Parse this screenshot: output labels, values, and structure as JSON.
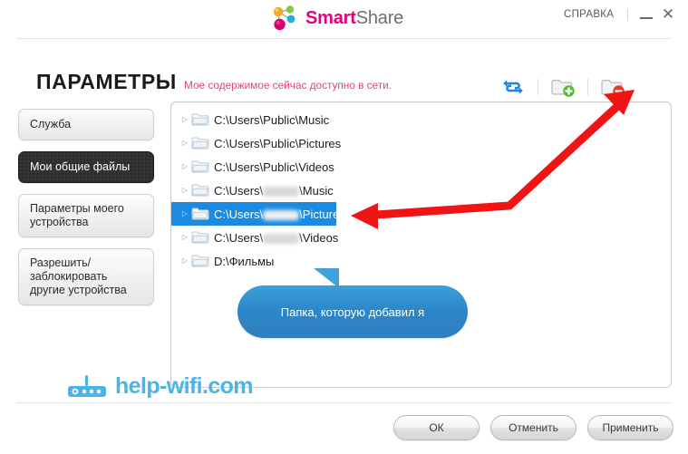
{
  "window": {
    "brand_smart": "Smart",
    "brand_share": "Share",
    "help_label": "СПРАВКА",
    "minimize_label": "—",
    "close_label": "✕",
    "brand_color": "#e4007f"
  },
  "sidebar": {
    "title": "ПАРАМЕТРЫ",
    "items": [
      {
        "label": "Служба",
        "active": false
      },
      {
        "label": "Мои общие файлы",
        "active": true
      },
      {
        "label": "Параметры моего\nустройства",
        "active": false
      },
      {
        "label": "Разрешить/\nзаблокировать\nдругие устройства",
        "active": false
      }
    ]
  },
  "main": {
    "status_note": "Мое содержимое сейчас доступно в сети.",
    "status_note_color": "#e0457b",
    "toolbar": [
      {
        "name": "refresh-icon",
        "title": "Обновить"
      },
      {
        "name": "add-folder-icon",
        "title": "Добавить папку"
      },
      {
        "name": "remove-folder-icon",
        "title": "Удалить папку"
      }
    ],
    "folder_list": [
      {
        "path": "C:\\Users\\Public\\Music",
        "selected": false,
        "redacted": false
      },
      {
        "path": "C:\\Users\\Public\\Pictures",
        "selected": false,
        "redacted": false
      },
      {
        "path": "C:\\Users\\Public\\Videos",
        "selected": false,
        "redacted": false
      },
      {
        "prefix": "C:\\Users\\",
        "suffix": "\\Music",
        "selected": false,
        "redacted": true
      },
      {
        "prefix": "C:\\Users\\",
        "suffix": "\\Pictures",
        "selected": true,
        "redacted": true
      },
      {
        "prefix": "C:\\Users\\",
        "suffix": "\\Videos",
        "selected": false,
        "redacted": true
      },
      {
        "path": "D:\\Фильмы",
        "selected": false,
        "redacted": false
      }
    ],
    "selection_color": "#1b8ae0"
  },
  "callout": {
    "text": "Папка, которую добавил я",
    "color": "#2f8fd0"
  },
  "watermark": {
    "text": "help-wifi.com",
    "color": "#4bb4e6"
  },
  "footer": {
    "buttons": [
      {
        "label": "ОК"
      },
      {
        "label": "Отменить"
      },
      {
        "label": "Применить"
      }
    ]
  },
  "annotation": {
    "arrow_color": "#f01414",
    "description": "Стрелка к кнопке удаления папки и к выделенной папке"
  }
}
